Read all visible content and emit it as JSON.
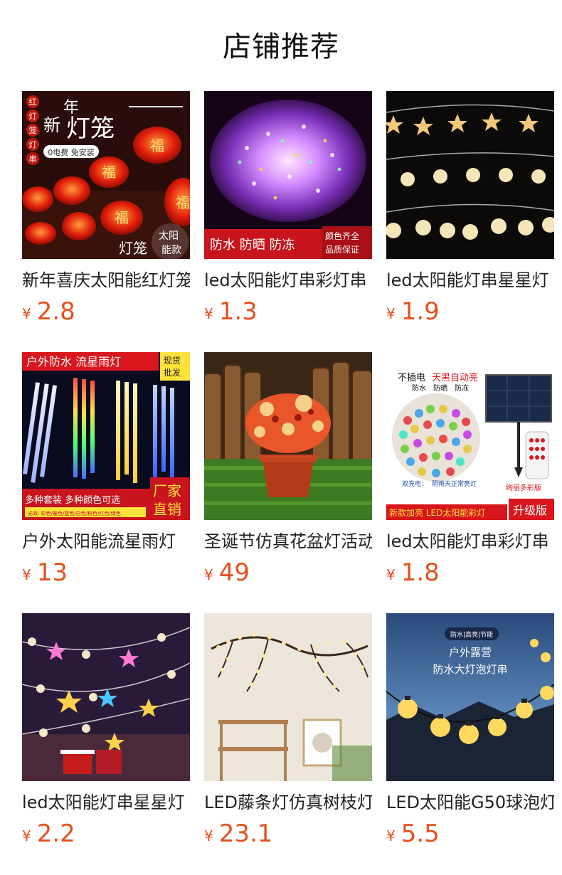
{
  "section": {
    "title": "店铺推荐"
  },
  "colors": {
    "price": "#e4501e",
    "text": "#222222"
  },
  "currency": "¥",
  "products": [
    {
      "name": "新年喜庆太阳能红灯笼",
      "price": "2.8",
      "image_text": {
        "side_chars": [
          "红",
          "灯",
          "笼",
          "灯",
          "串"
        ],
        "headline_small": "新",
        "headline_top": "年",
        "headline_main": "灯笼",
        "tag": "0电费 免安装",
        "lantern_char": "福",
        "corner_a": "灯笼",
        "corner_b": "太阳",
        "corner_c": "能款"
      }
    },
    {
      "name": "led太阳能灯串彩灯串",
      "price": "1.3",
      "image_text": {
        "banner": "防水 防晒 防冻",
        "badge_1": "颜色齐全",
        "badge_2": "品质保证"
      }
    },
    {
      "name": "led太阳能灯串星星灯",
      "price": "1.9"
    },
    {
      "name": "户外太阳能流星雨灯",
      "price": "13",
      "image_text": {
        "banner": "户外防水 流星雨灯",
        "badge_1": "现货",
        "badge_2": "批发",
        "footer": "多种套装 多种颜色可选",
        "footer_small": "光效: 彩色/暖色/蓝色/白色/粉色/红色/绿色",
        "stamp_1": "厂家",
        "stamp_2": "直销"
      }
    },
    {
      "name": "圣诞节仿真花盆灯活动",
      "price": "49"
    },
    {
      "name": "led太阳能灯串彩灯串",
      "price": "1.8",
      "image_text": {
        "line_a": "不插电",
        "line_b": "天黑自动亮",
        "line_c": "防水",
        "line_d": "防晒",
        "line_e": "防冻",
        "caption_1": "双充电：",
        "caption_2": "阴雨天正常亮灯",
        "caption_3": "绚丽多彩版",
        "footer": "新款加亮 LED太阳能彩灯",
        "stamp": "升级版"
      }
    },
    {
      "name": "led太阳能灯串星星灯",
      "price": "2.2"
    },
    {
      "name": "LED藤条灯仿真树枝灯",
      "price": "23.1"
    },
    {
      "name": "LED太阳能G50球泡灯",
      "price": "5.5",
      "image_text": {
        "top_small": "防水|高亮|节能",
        "headline_1": "户外露营",
        "headline_2": "防水大灯泡灯串"
      }
    }
  ]
}
